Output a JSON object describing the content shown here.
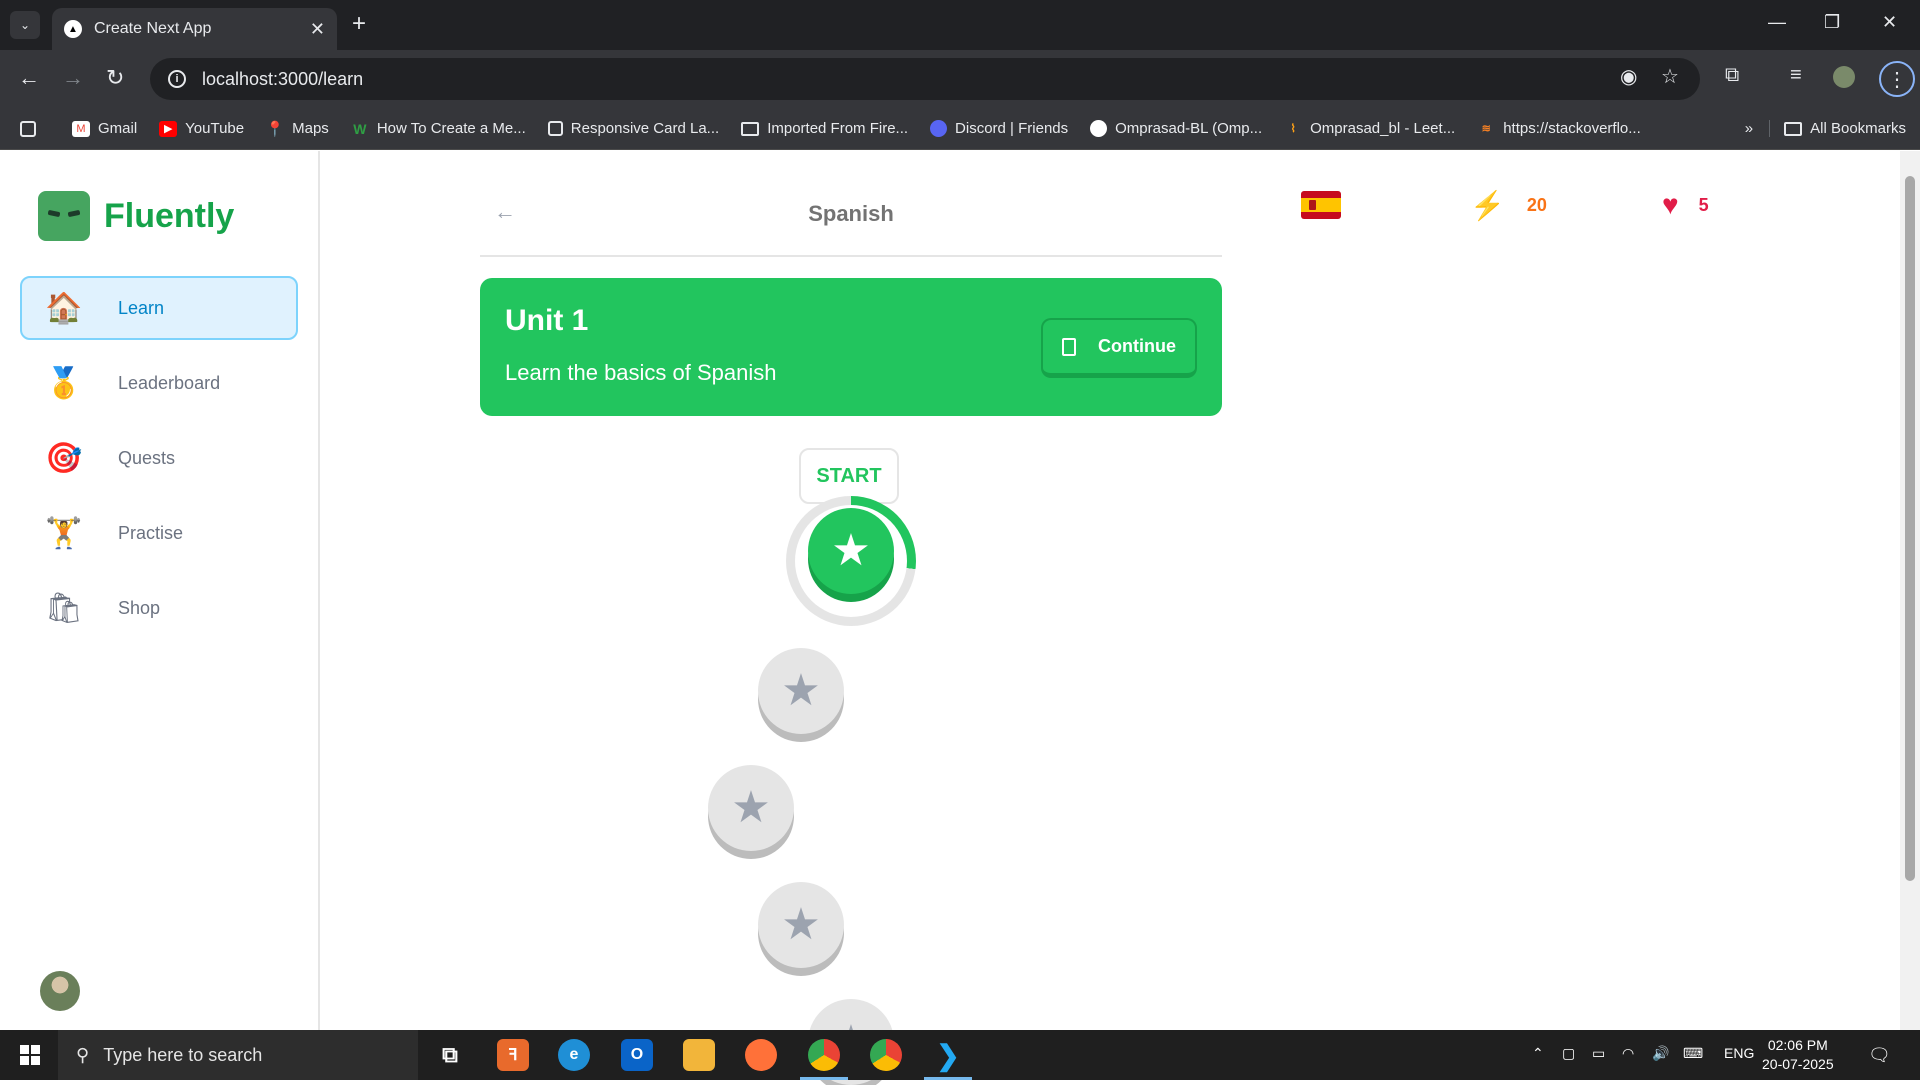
{
  "browser": {
    "tab_title": "Create Next App",
    "tab_favicon": "▲",
    "url": "localhost:3000/learn",
    "bookmarks": [
      {
        "label": "Gmail",
        "icon": "gmail-icon",
        "color": "#ea4335"
      },
      {
        "label": "YouTube",
        "icon": "youtube-icon",
        "color": "#ff0000"
      },
      {
        "label": "Maps",
        "icon": "maps-icon",
        "color": "#34a853"
      },
      {
        "label": "How To Create a Me...",
        "icon": "w-icon",
        "color": "#2f9e44"
      },
      {
        "label": "Responsive Card La...",
        "icon": "page-icon",
        "color": "#e8eaed"
      },
      {
        "label": "Imported From Fire...",
        "icon": "folder-icon",
        "color": "#e8eaed"
      },
      {
        "label": "Discord | Friends",
        "icon": "discord-icon",
        "color": "#5865f2"
      },
      {
        "label": "Omprasad-BL (Omp...",
        "icon": "github-icon",
        "color": "#ffffff"
      },
      {
        "label": "Omprasad_bl - Leet...",
        "icon": "leetcode-icon",
        "color": "#ffa116"
      },
      {
        "label": "https://stackoverflo...",
        "icon": "stackoverflow-icon",
        "color": "#f48024"
      }
    ],
    "all_bookmarks": "All Bookmarks"
  },
  "app": {
    "brand": "Fluently",
    "nav": [
      {
        "label": "Learn",
        "icon": "house-icon",
        "glyph": "🏠",
        "active": true
      },
      {
        "label": "Leaderboard",
        "icon": "medal-icon",
        "glyph": "🥇",
        "active": false
      },
      {
        "label": "Quests",
        "icon": "target-icon",
        "glyph": "🎯",
        "active": false
      },
      {
        "label": "Practise",
        "icon": "dumbbell-icon",
        "glyph": "🏋",
        "active": false
      },
      {
        "label": "Shop",
        "icon": "shopping-bag-icon",
        "glyph": "🛍",
        "active": false
      }
    ],
    "header": {
      "title": "Spanish",
      "back_glyph": "←"
    },
    "unit": {
      "title": "Unit 1",
      "description": "Learn the basics of Spanish",
      "continue_label": "Continue"
    },
    "start_label": "START",
    "lesson_progress": 0.27,
    "stats": {
      "language_flag": "spain-flag-icon",
      "points": "20",
      "hearts": "5",
      "points_color": "#f97316",
      "hearts_color": "#e11d48"
    },
    "colors": {
      "primary": "#22c55e",
      "primary_dark": "#16a34a",
      "active_nav_bg": "#e0f2fe",
      "active_nav_text": "#0284c7"
    }
  },
  "taskbar": {
    "search_placeholder": "Type here to search",
    "language": "ENG",
    "time": "02:06 PM",
    "date": "20-07-2025"
  }
}
